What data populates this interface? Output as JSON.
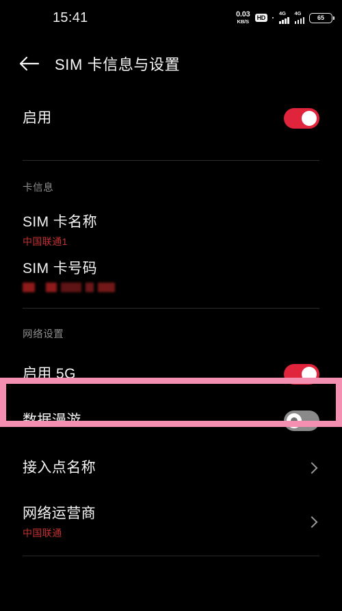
{
  "status_bar": {
    "clock": "15:41",
    "net_speed_value": "0.03",
    "net_speed_unit": "KB/S",
    "hd_badge": "HD",
    "sim1_network": "4G",
    "sim2_network": "4G",
    "battery_level": "65"
  },
  "app_bar": {
    "back_icon": "arrow-left-icon",
    "title": "SIM 卡信息与设置"
  },
  "enable_row": {
    "label": "启用",
    "toggle_state": "on"
  },
  "card_info_section": {
    "header": "卡信息",
    "sim_name": {
      "label": "SIM 卡名称",
      "value": "中国联通1"
    },
    "sim_number": {
      "label": "SIM 卡号码",
      "value_redacted": true
    }
  },
  "network_section": {
    "header": "网络设置",
    "enable_5g": {
      "label": "启用 5G",
      "toggle_state": "on",
      "highlighted": true,
      "highlight_color": "#f48fb1"
    },
    "data_roaming": {
      "label": "数据漫游",
      "toggle_state": "off"
    },
    "apn": {
      "label": "接入点名称",
      "chevron_icon": "chevron-right-icon"
    },
    "carrier": {
      "label": "网络运营商",
      "value": "中国联通",
      "chevron_icon": "chevron-right-icon"
    }
  },
  "colors": {
    "background": "#000000",
    "toggle_on": "#e0243c",
    "toggle_off": "#8a8a8a",
    "accent_red_text": "#c23131",
    "section_header": "#8d8d8d",
    "divider": "#2a2a2a",
    "highlight": "#f48fb1"
  }
}
